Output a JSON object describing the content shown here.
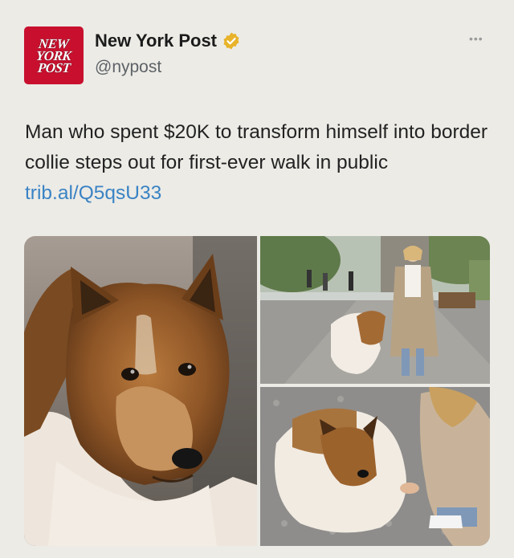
{
  "account": {
    "avatar_lines": [
      "NEW",
      "YORK",
      "POST"
    ],
    "display_name": "New York Post",
    "handle": "@nypost",
    "verified": true,
    "verified_color": "#e8b32a",
    "brand_color": "#c8102e"
  },
  "more_icon": "more-horizontal-icon",
  "more_glyph": "•••",
  "tweet": {
    "text": "Man who spent $20K to transform himself into border collie steps out for first-ever walk in public ",
    "link": "trib.al/Q5qsU33",
    "link_color": "#3a83c4"
  },
  "media": {
    "count": 3
  }
}
